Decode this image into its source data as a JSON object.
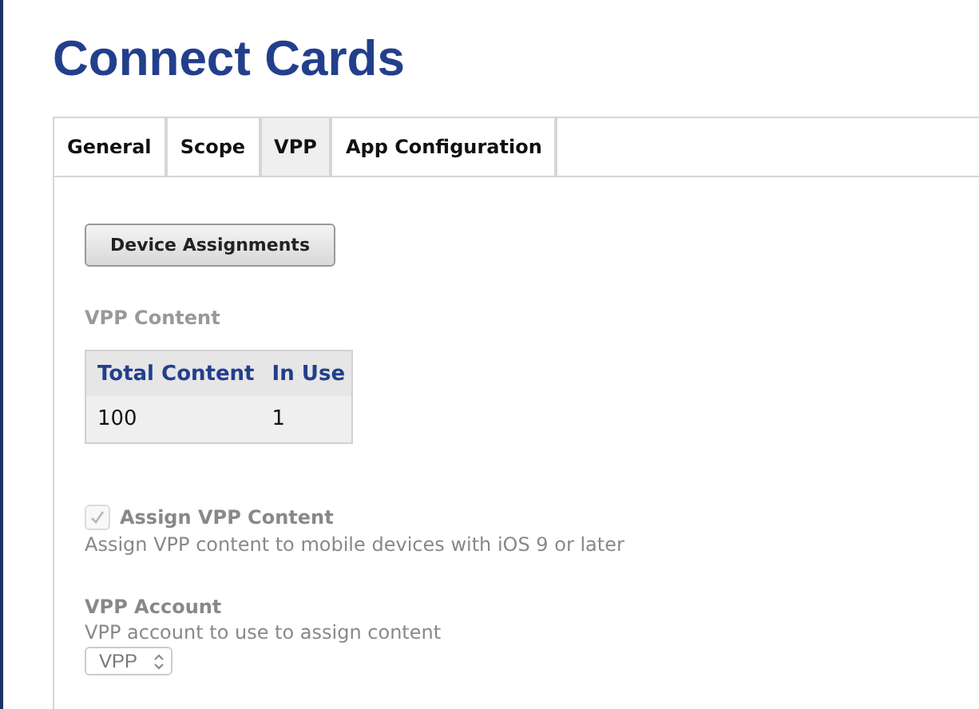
{
  "title": "Connect Cards",
  "tabs": [
    {
      "label": "General",
      "selected": false
    },
    {
      "label": "Scope",
      "selected": false
    },
    {
      "label": "VPP",
      "selected": true
    },
    {
      "label": "App Configuration",
      "selected": false
    }
  ],
  "device_assignments_button": "Device Assignments",
  "vpp_content": {
    "heading": "VPP Content",
    "columns": [
      "Total Content",
      "In Use"
    ],
    "rows": [
      [
        "100",
        "1"
      ]
    ]
  },
  "assign_vpp_content": {
    "label": "Assign VPP Content",
    "checked": true,
    "disabled": true,
    "description": "Assign VPP content to mobile devices with iOS 9 or later"
  },
  "vpp_account": {
    "label": "VPP Account",
    "description": "VPP account to use to assign content",
    "value": "VPP",
    "disabled": true
  }
}
